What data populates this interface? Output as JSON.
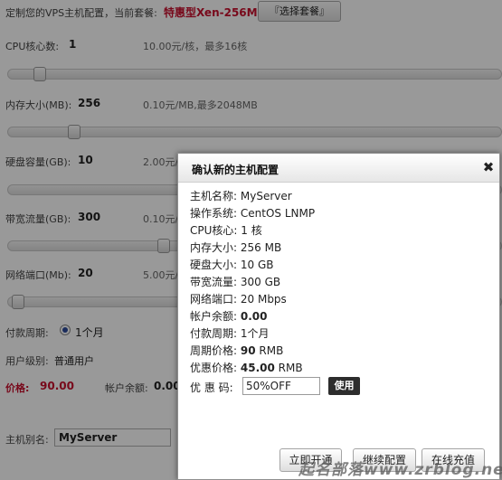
{
  "config": {
    "intro_label": "定制您的VPS主机配置，当前套餐:",
    "package_name": "特惠型Xen-256M",
    "choose_package_button": "『选择套餐』",
    "cpu": {
      "label": "CPU核心数:",
      "value": "1",
      "hint": "10.00元/核，最多16核",
      "level": 0.04
    },
    "memory": {
      "label": "内存大小(MB):",
      "value": "256",
      "hint": "0.10元/MB,最多2048MB",
      "level": 0.12
    },
    "disk": {
      "label": "硬盘容量(GB):",
      "value": "10",
      "hint": "2.00元/"
    },
    "bandwidth": {
      "label": "带宽流量(GB):",
      "value": "300",
      "hint": "0.10元/"
    },
    "port": {
      "label": "网络端口(Mb):",
      "value": "20",
      "hint": "5.00元/"
    },
    "payment_label": "付款周期:",
    "payment_option": "1个月",
    "user_level_label": "用户级别:",
    "user_level_value": "普通用户",
    "price_label": "价格:",
    "price_value": "90.00",
    "balance_label": "帐户余额:",
    "balance_value": "0.00",
    "alias_label": "主机别名:",
    "alias_value": "MyServer"
  },
  "dialog": {
    "title": "确认新的主机配置",
    "rows": [
      {
        "label": "主机名称:",
        "value": "MyServer"
      },
      {
        "label": "操作系统:",
        "value": "CentOS LNMP"
      },
      {
        "label": "CPU核心:",
        "value": "1 核"
      },
      {
        "label": "内存大小:",
        "value": "256 MB"
      },
      {
        "label": "硬盘大小:",
        "value": "10 GB"
      },
      {
        "label": "带宽流量:",
        "value": "300 GB"
      },
      {
        "label": "网络端口:",
        "value": "20 Mbps"
      },
      {
        "label": "帐户余额:",
        "value": "0.00"
      },
      {
        "label": "付款周期:",
        "value": "1个月"
      },
      {
        "label": "周期价格:",
        "value": "90",
        "unit": "RMB"
      },
      {
        "label": "优惠价格:",
        "value": "45.00",
        "unit": "RMB"
      }
    ],
    "coupon_label": "优 惠 码:",
    "coupon_value": "50%OFF",
    "use_button": "使用",
    "buttons": {
      "open_now": "立即开通",
      "continue_config": "继续配置",
      "recharge": "在线充值"
    }
  },
  "watermark": "起名部落www.zrblog.net",
  "colors": {
    "package_name": "#c8102e",
    "price": "#c8102e",
    "use_button": "#2d2d2d"
  }
}
